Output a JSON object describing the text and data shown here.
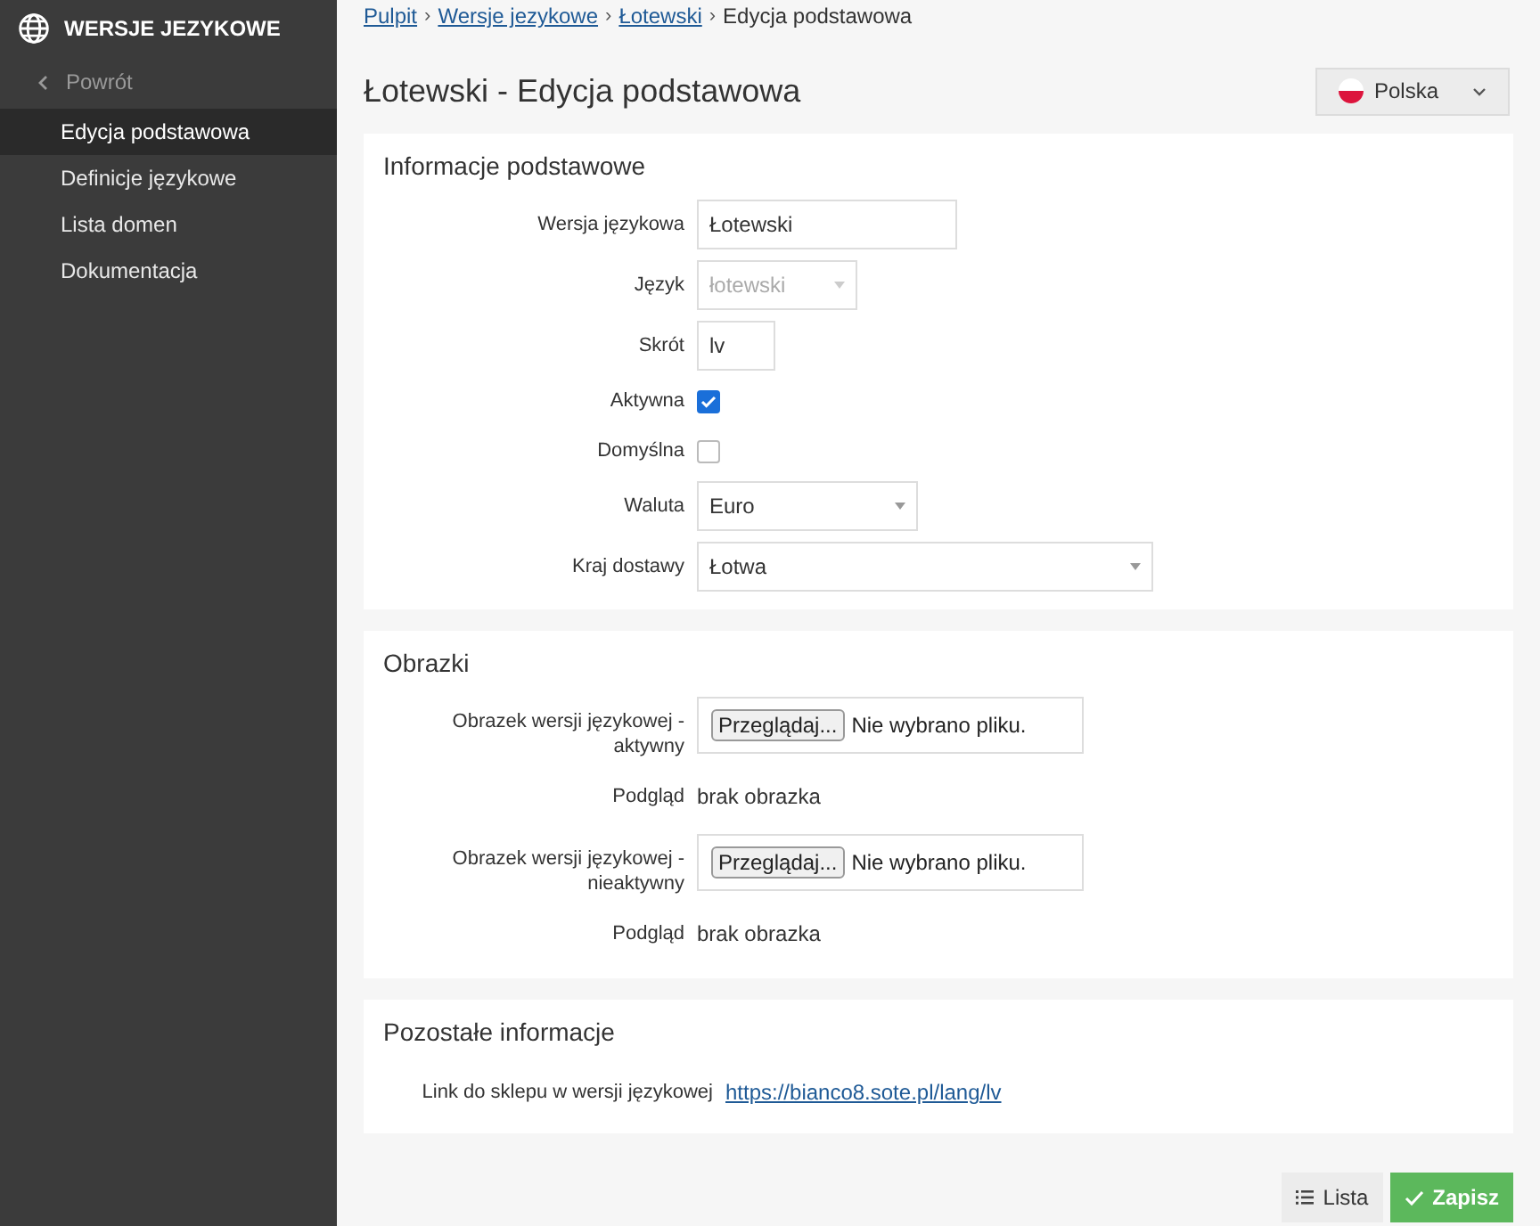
{
  "sidebar": {
    "title": "WERSJE JEZYKOWE",
    "back": "Powrót",
    "items": [
      {
        "label": "Edycja podstawowa",
        "selected": true
      },
      {
        "label": "Definicje językowe",
        "selected": false
      },
      {
        "label": "Lista domen",
        "selected": false
      },
      {
        "label": "Dokumentacja",
        "selected": false
      }
    ]
  },
  "breadcrumbs": [
    {
      "label": "Pulpit",
      "link": true
    },
    {
      "label": "Wersje jezykowe",
      "link": true
    },
    {
      "label": "Łotewski",
      "link": true
    },
    {
      "label": "Edycja podstawowa",
      "link": false
    }
  ],
  "separator": "›",
  "page_title": "Łotewski - Edycja podstawowa",
  "language_select": {
    "value": "Polska"
  },
  "sections": [
    {
      "title": "Informacje podstawowe",
      "rows": [
        {
          "kind": "text",
          "label": "Wersja językowa",
          "value": "Łotewski"
        },
        {
          "kind": "select",
          "label": "Język",
          "value": "łotewski",
          "disabled": true
        },
        {
          "kind": "text",
          "label": "Skrót",
          "value": "lv"
        },
        {
          "kind": "checkbox",
          "label": "Aktywna",
          "checked": true
        },
        {
          "kind": "checkbox",
          "label": "Domyślna",
          "checked": false
        },
        {
          "kind": "select",
          "label": "Waluta",
          "value": "Euro",
          "disabled": false
        },
        {
          "kind": "select",
          "label": "Kraj dostawy",
          "value": "Łotwa",
          "disabled": false
        }
      ]
    },
    {
      "title": "Obrazki",
      "rows": [
        {
          "kind": "file",
          "label": "Obrazek wersji językowej - aktywny",
          "button": "Przeglądaj...",
          "value": "Nie wybrano pliku."
        },
        {
          "kind": "static",
          "label": "Podgląd",
          "value": "brak obrazka"
        },
        {
          "kind": "file",
          "label": "Obrazek wersji językowej - nieaktywny",
          "button": "Przeglądaj...",
          "value": "Nie wybrano pliku."
        },
        {
          "kind": "static",
          "label": "Podgląd",
          "value": "brak obrazka"
        }
      ]
    },
    {
      "title": "Pozostałe informacje",
      "rows": [
        {
          "kind": "link",
          "label": "Link do sklepu w wersji językowej",
          "value": "https://bianco8.sote.pl/lang/lv"
        }
      ]
    }
  ],
  "buttons": [
    {
      "label": "Lista",
      "kind": "list"
    },
    {
      "label": "Zapisz",
      "kind": "save"
    }
  ]
}
